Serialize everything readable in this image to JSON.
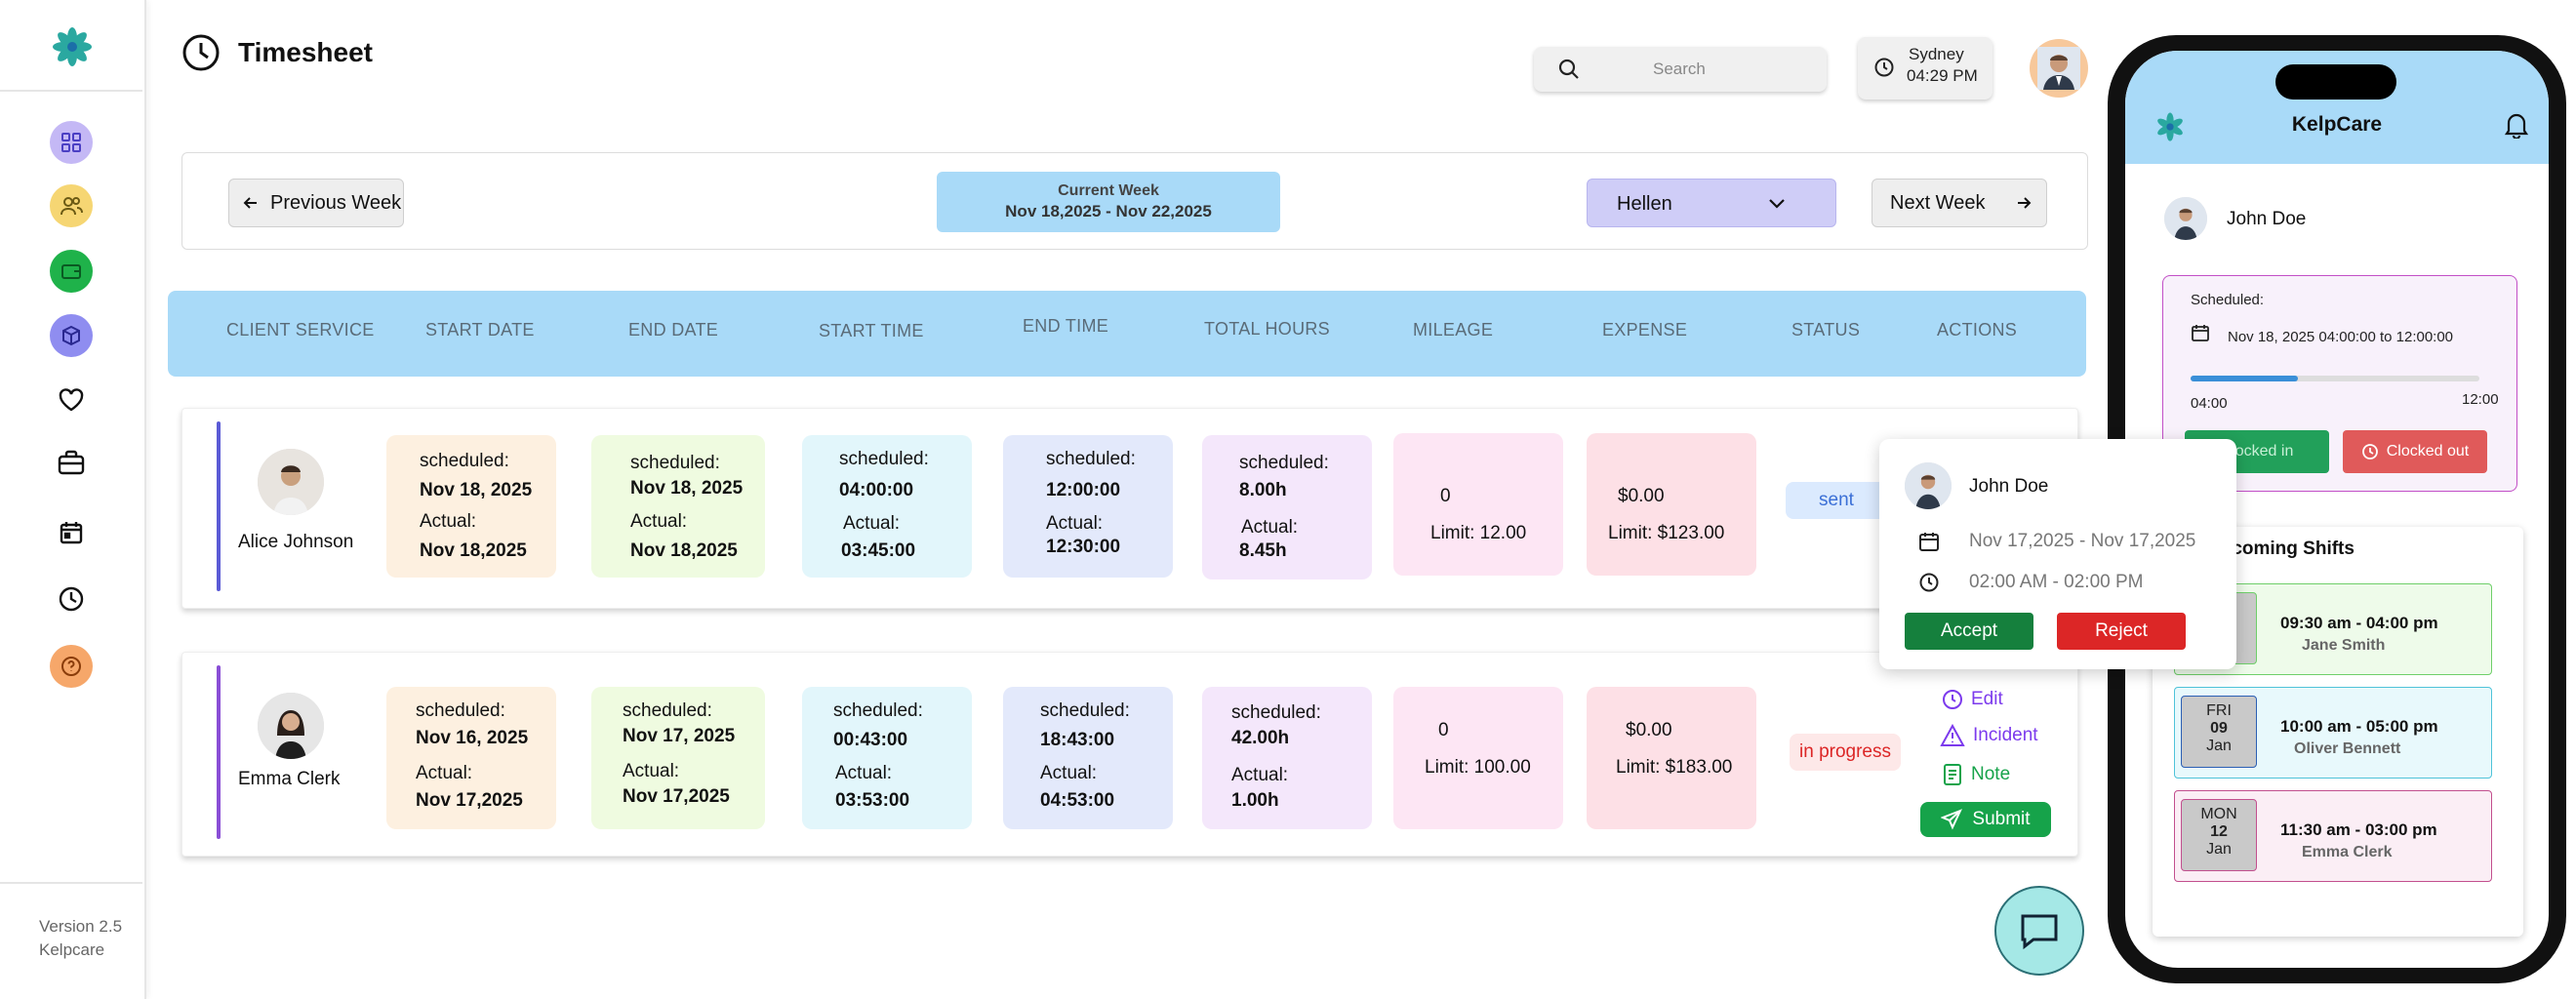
{
  "app": {
    "title": "Timesheet"
  },
  "sidebar": {
    "items": [
      {
        "icon": "dashboard-grid-icon",
        "bg": "#c4b8f5"
      },
      {
        "icon": "users-icon",
        "bg": "#f6d673"
      },
      {
        "icon": "wallet-icon",
        "bg": "#1fb24a"
      },
      {
        "icon": "cube-icon",
        "bg": "#8f8df0"
      },
      {
        "icon": "heart-icon",
        "bg": ""
      },
      {
        "icon": "briefcase-icon",
        "bg": ""
      },
      {
        "icon": "calendar-icon",
        "bg": ""
      },
      {
        "icon": "clock-icon",
        "bg": ""
      },
      {
        "icon": "help-icon",
        "bg": "#f6a76a"
      }
    ],
    "version_line1": "Version 2.5",
    "version_line2": "Kelpcare"
  },
  "header": {
    "search_placeholder": "Search",
    "city": "Sydney",
    "time": "04:29 PM"
  },
  "week": {
    "prev_label": "Previous Week",
    "next_label": "Next Week",
    "current_label": "Current Week",
    "current_range": "Nov 18,2025 - Nov 22,2025",
    "selected_staff": "Hellen"
  },
  "table": {
    "columns": [
      "CLIENT SERVICE",
      "START DATE",
      "END DATE",
      "START TIME",
      "END TIME",
      "TOTAL HOURS",
      "MILEAGE",
      "EXPENSE",
      "STATUS",
      "ACTIONS"
    ],
    "rows": [
      {
        "name": "Alice Johnson",
        "start_date": {
          "l1": "scheduled:",
          "v1": "Nov 18, 2025",
          "l2": "Actual:",
          "v2": "Nov 18,2025"
        },
        "end_date": {
          "l1": "scheduled:",
          "v1": "Nov 18, 2025",
          "l2": "Actual:",
          "v2": "Nov 18,2025"
        },
        "start_time": {
          "l1": "scheduled:",
          "v1": "04:00:00",
          "l2": "Actual:",
          "v2": "03:45:00"
        },
        "end_time": {
          "l1": "scheduled:",
          "v1": "12:00:00",
          "l2": "Actual:",
          "v2": "12:30:00"
        },
        "total_hours": {
          "l1": "scheduled:",
          "v1": "8.00h",
          "l2": "Actual:",
          "v2": "8.45h"
        },
        "mileage": {
          "v": "0",
          "limit": "Limit: 12.00"
        },
        "expense": {
          "v": "$0.00",
          "limit": "Limit: $123.00"
        },
        "status": "sent"
      },
      {
        "name": "Emma Clerk",
        "start_date": {
          "l1": "scheduled:",
          "v1": "Nov 16, 2025",
          "l2": "Actual:",
          "v2": "Nov 17,2025"
        },
        "end_date": {
          "l1": "scheduled:",
          "v1": "Nov 17, 2025",
          "l2": "Actual:",
          "v2": "Nov 17,2025"
        },
        "start_time": {
          "l1": "scheduled:",
          "v1": "00:43:00",
          "l2": "Actual:",
          "v2": "03:53:00"
        },
        "end_time": {
          "l1": "scheduled:",
          "v1": "18:43:00",
          "l2": "Actual:",
          "v2": "04:53:00"
        },
        "total_hours": {
          "l1": "scheduled:",
          "v1": "42.00h",
          "l2": "Actual:",
          "v2": "1.00h"
        },
        "mileage": {
          "v": "0",
          "limit": "Limit: 100.00"
        },
        "expense": {
          "v": "$0.00",
          "limit": "Limit: $183.00"
        },
        "status": "in progress"
      }
    ],
    "actions": {
      "edit": "Edit",
      "incident": "Incident",
      "note": "Note",
      "submit": "Submit"
    }
  },
  "popover": {
    "name": "John Doe",
    "date_range": "Nov 17,2025 - Nov 17,2025",
    "time_range": "02:00 AM - 02:00 PM",
    "accept": "Accept",
    "reject": "Reject"
  },
  "phone": {
    "app_title": "KelpCare",
    "user": "John Doe",
    "scheduled_label": "Scheduled:",
    "scheduled_value": "Nov 18, 2025  04:00:00 to 12:00:00",
    "progress_start": "04:00",
    "progress_end": "12:00",
    "progress_fraction": 0.37,
    "clock_in": "Clocked in",
    "clock_out": "Clocked out",
    "shifts_title": "Upcoming Shifts",
    "shifts": [
      {
        "dow": "",
        "day": "",
        "month": "",
        "time": "09:30 am - 04:00 pm",
        "who": "Jane Smith",
        "bg": "#eefbea",
        "border": "#6fcf6a"
      },
      {
        "dow": "FRI",
        "day": "09",
        "month": "Jan",
        "time": "10:00 am - 05:00 pm",
        "who": "Oliver Bennett",
        "bg": "#e8f9fc",
        "border": "#4fc3d9"
      },
      {
        "dow": "MON",
        "day": "12",
        "month": "Jan",
        "time": "11:30 am - 03:00 pm",
        "who": "Emma Clerk",
        "bg": "#fbeef5",
        "border": "#c24f8e"
      }
    ]
  },
  "colors": {
    "accent_blue": "#a9daf8",
    "accept_green": "#15803d",
    "reject_red": "#dc2626",
    "status_sent_bg": "#dbeafe",
    "status_progress_bg": "#fde8e8"
  }
}
